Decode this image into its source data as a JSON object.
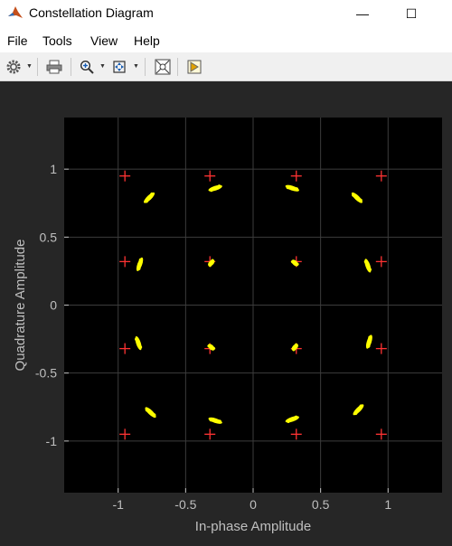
{
  "window": {
    "title": "Constellation Diagram",
    "minimize_glyph": "—",
    "maximize_glyph": "☐"
  },
  "menu": {
    "items": [
      "File",
      "Tools",
      "View",
      "Help"
    ]
  },
  "toolbar": {
    "icons": [
      "gear-icon",
      "print-icon",
      "zoom-in-icon",
      "zoom-extents-icon",
      "autoscale-icon",
      "measurements-icon"
    ]
  },
  "colors": {
    "figure_bg": "#262626",
    "axes_bg": "#000000",
    "grid": "#3c3c3c",
    "text": "#bfbfbf",
    "received": "#ffff00",
    "reference": "#ff3333"
  },
  "chart_data": {
    "type": "scatter",
    "title": "",
    "xlabel": "In-phase Amplitude",
    "ylabel": "Quadrature Amplitude",
    "xlim": [
      -1.4,
      1.4
    ],
    "ylim": [
      -1.38,
      1.38
    ],
    "xticks": [
      -1,
      -0.5,
      0,
      0.5,
      1
    ],
    "xtick_labels": [
      "-1",
      "-0.5",
      "0",
      "0.5",
      "1"
    ],
    "yticks": [
      1,
      0.5,
      0,
      -0.5,
      -1
    ],
    "ytick_labels": [
      "1",
      "0.5",
      "0",
      "-0.5",
      "-1"
    ],
    "grid": true,
    "legend": false,
    "series": [
      {
        "marker": "+",
        "points": [
          [
            -0.95,
            0.95
          ],
          [
            -0.32,
            0.95
          ],
          [
            0.32,
            0.95
          ],
          [
            0.95,
            0.95
          ],
          [
            -0.95,
            0.32
          ],
          [
            -0.32,
            0.32
          ],
          [
            0.32,
            0.32
          ],
          [
            0.95,
            0.32
          ],
          [
            -0.95,
            -0.32
          ],
          [
            -0.32,
            -0.32
          ],
          [
            0.32,
            -0.32
          ],
          [
            0.95,
            -0.32
          ],
          [
            -0.95,
            -0.95
          ],
          [
            -0.32,
            -0.95
          ],
          [
            0.32,
            -0.95
          ],
          [
            0.95,
            -0.95
          ]
        ]
      },
      {
        "marker": "dot-cluster",
        "points": [
          [
            -0.77,
            0.79
          ],
          [
            -0.28,
            0.86
          ],
          [
            0.29,
            0.86
          ],
          [
            0.77,
            0.79
          ],
          [
            -0.84,
            0.3
          ],
          [
            -0.31,
            0.31
          ],
          [
            0.31,
            0.31
          ],
          [
            0.85,
            0.29
          ],
          [
            -0.85,
            -0.28
          ],
          [
            -0.31,
            -0.31
          ],
          [
            0.31,
            -0.31
          ],
          [
            0.86,
            -0.27
          ],
          [
            -0.76,
            -0.79
          ],
          [
            -0.28,
            -0.85
          ],
          [
            0.29,
            -0.84
          ],
          [
            0.78,
            -0.77
          ]
        ]
      }
    ]
  }
}
